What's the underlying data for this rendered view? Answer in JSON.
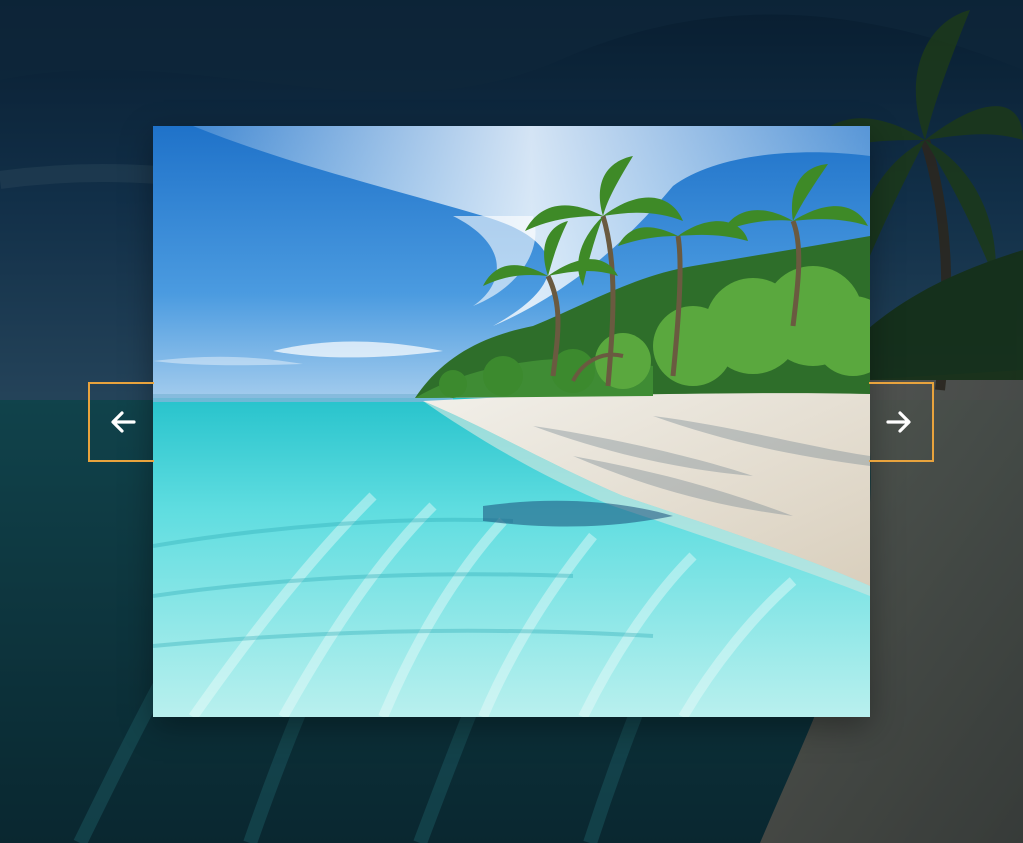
{
  "lightbox": {
    "image": {
      "subject": "tropical-beach"
    },
    "controls": {
      "prev_icon": "arrow-left-icon",
      "next_icon": "arrow-right-icon"
    }
  },
  "colors": {
    "accent": "#e8a33d",
    "arrow": "#ffffff",
    "backdrop": "#0c2233"
  }
}
